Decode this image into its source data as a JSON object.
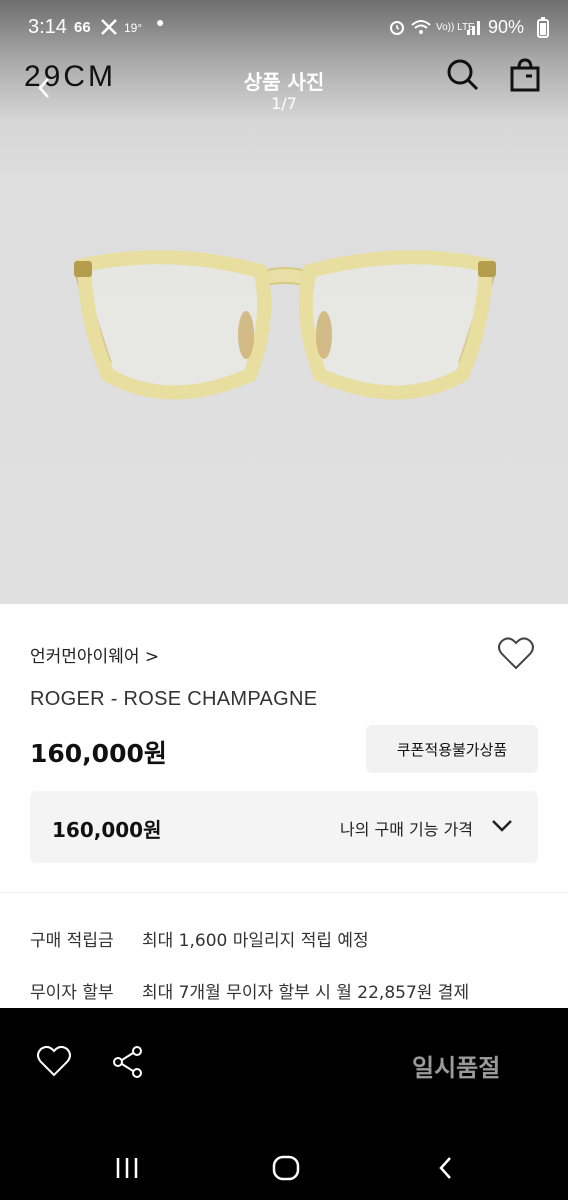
{
  "status_bar": {
    "time": "3:14",
    "indicator_1": "66",
    "indicator_2": "19°",
    "network": "Vo)) LTE",
    "battery": "90%"
  },
  "header": {
    "brand": "29CM",
    "title": "상품 사진",
    "page_indicator": "1/7"
  },
  "product": {
    "brand_link": "언커먼아이웨어 >",
    "name": "ROGER - ROSE CHAMPAGNE",
    "price": "160,000원",
    "coupon_label": "쿠폰적용불가상품",
    "my_price_value": "160,000원",
    "my_price_label": "나의 구매 기능 가격"
  },
  "benefits": [
    {
      "label": "구매 적립금",
      "value": "최대 1,600 마일리지 적립 예정"
    },
    {
      "label": "무이자 할부",
      "value": "최대 7개월 무이자 할부 시 월 22,857원 결제"
    }
  ],
  "bottom_bar": {
    "soldout_label": "일시품절"
  },
  "colors": {
    "frame": "#e4dba0",
    "frame_dark": "#c9b86a",
    "bottom_bar_bg": "#000000"
  },
  "icons": [
    "back-icon",
    "search-icon",
    "shopping-bag-icon",
    "heart-icon",
    "share-icon",
    "chevron-down-icon",
    "recents-icon",
    "home-icon",
    "nav-back-icon"
  ]
}
